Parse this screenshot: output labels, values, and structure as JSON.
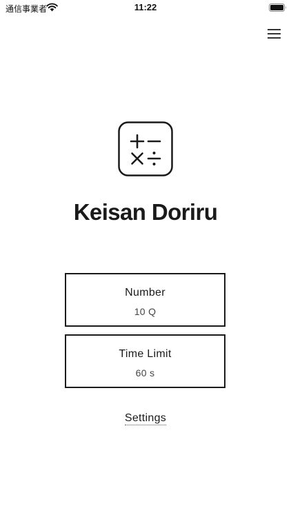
{
  "status_bar": {
    "carrier": "通信事業者",
    "time": "11:22"
  },
  "header": {
    "menu_icon": "hamburger-menu-icon"
  },
  "app": {
    "icon": "math-operators-icon",
    "title": "Keisan Doriru"
  },
  "options": {
    "number": {
      "label": "Number",
      "value": "10 Q"
    },
    "time_limit": {
      "label": "Time Limit",
      "value": "60 s"
    }
  },
  "footer": {
    "settings_label": "Settings"
  }
}
